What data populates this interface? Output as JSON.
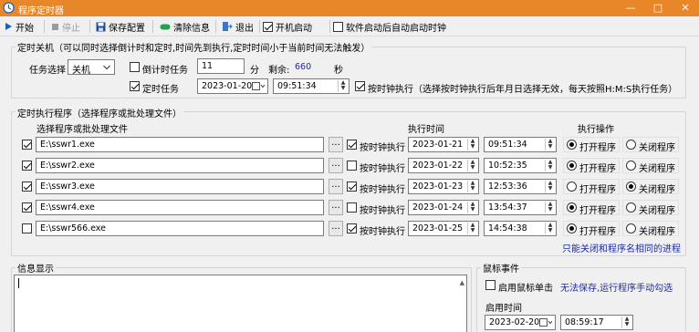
{
  "window": {
    "title": "程序定时器",
    "minimize": "—",
    "maximize": "□",
    "close": "✕"
  },
  "toolbar": {
    "start": "开始",
    "stop": "停止",
    "save": "保存配置",
    "clear": "清除信息",
    "exit": "退出",
    "autostart": "开机启动",
    "auto_timer": "软件启动后自动启动时钟"
  },
  "shutdown": {
    "group_title": "定时关机（可以同时选择倒计时和定时,时间先到执行,定时时间小于当前时间无法触发）",
    "task_label": "任务选择",
    "task_value": "关机",
    "countdown_label": "倒计时任务",
    "countdown_value": "11",
    "minute_unit": "分",
    "remaining_label": "剩余:",
    "remaining_value": "660",
    "second_unit": "秒",
    "timed_label": "定时任务",
    "timed_date": "2023-01-20",
    "timed_time": "09:51:34",
    "clock_label": "按时钟执行（选择按时钟执行后年月日选择无效，每天按照H:M:S执行任务）"
  },
  "programs": {
    "group_title": "定时执行程序（选择程序或批处理文件）",
    "col_file": "选择程序或批处理文件",
    "col_time": "执行时间",
    "col_action": "执行操作",
    "browse": "...",
    "clock_label": "按时钟执行",
    "open_label": "打开程序",
    "close_label": "关闭程序",
    "rows": [
      {
        "path": "E:\\sswr1.exe",
        "date": "2023-01-21",
        "time": "09:51:34"
      },
      {
        "path": "E:\\sswr2.exe",
        "date": "2023-01-22",
        "time": "10:52:35"
      },
      {
        "path": "E:\\sswr3.exe",
        "date": "2023-01-23",
        "time": "12:53:36"
      },
      {
        "path": "E:\\sswr4.exe",
        "date": "2023-01-24",
        "time": "13:54:37"
      },
      {
        "path": "E:\\sswr566.exe",
        "date": "2023-01-25",
        "time": "14:54:38"
      }
    ],
    "note": "只能关闭和程序名相同的进程"
  },
  "info": {
    "group_title": "信息显示",
    "content": ""
  },
  "mouse": {
    "group_title": "鼠标事件",
    "enable_label": "启用鼠标单击",
    "note": "无法保存,运行程序手动勾选",
    "start_time_label": "启用时间",
    "date": "2023-02-20",
    "time": "08:59:17"
  },
  "colors": {
    "titlebar": "#e8862a",
    "link_blue": "#1f2ba6"
  }
}
